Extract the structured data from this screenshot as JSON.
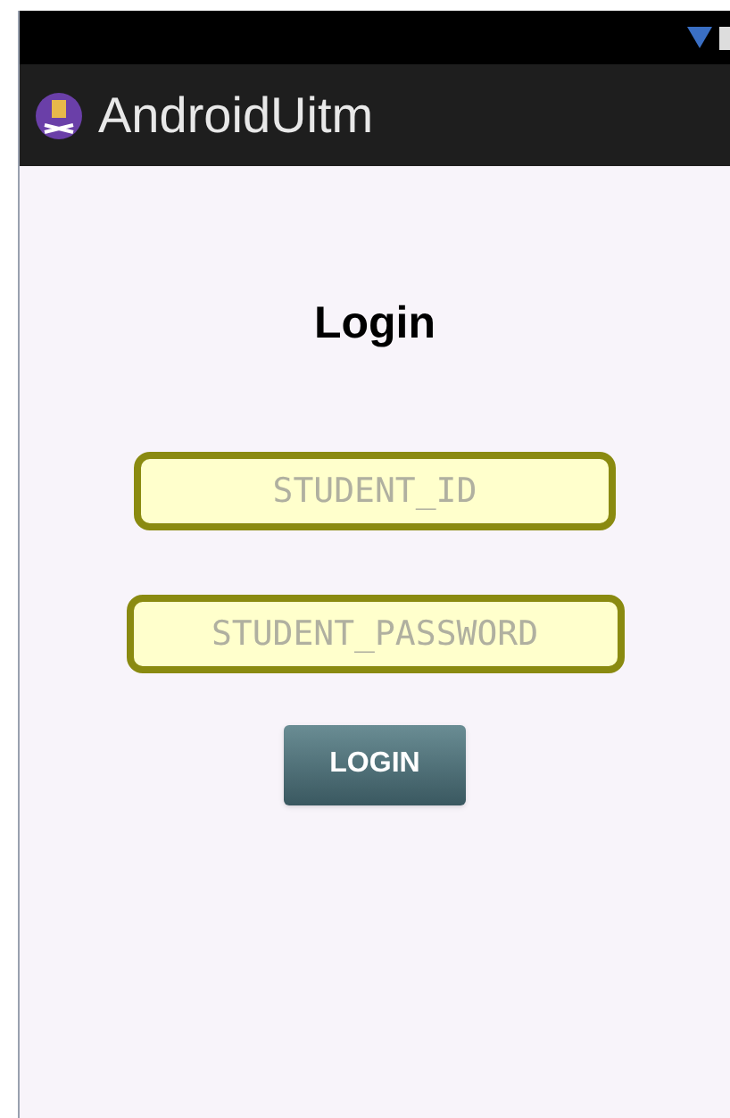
{
  "app_bar": {
    "title": "AndroidUitm"
  },
  "form": {
    "heading": "Login",
    "fields": [
      {
        "placeholder": "STUDENT_ID"
      },
      {
        "placeholder": "STUDENT_PASSWORD"
      }
    ],
    "button": "LOGIN"
  }
}
